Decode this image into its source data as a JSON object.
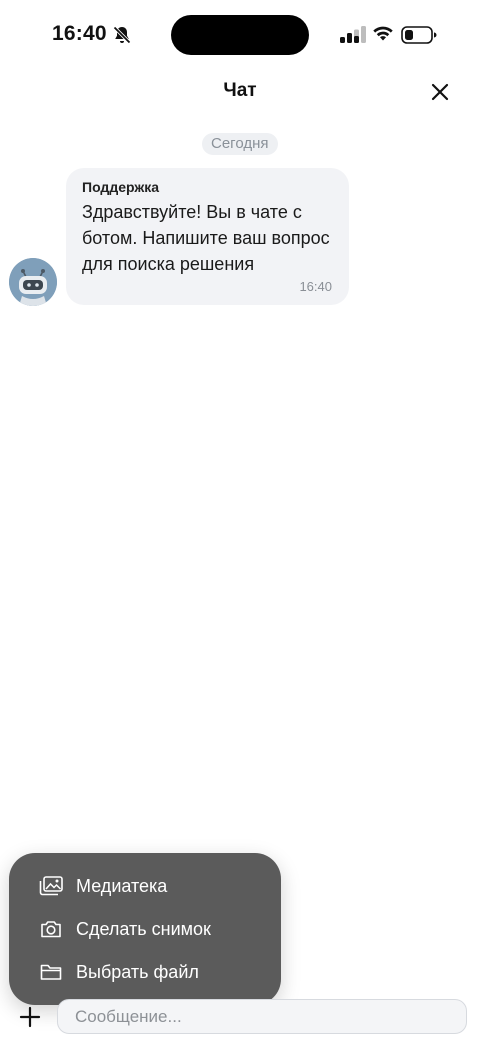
{
  "status_bar": {
    "time": "16:40",
    "icons": [
      "bell-slash-icon",
      "cellular-signal-icon",
      "wifi-icon",
      "battery-icon"
    ]
  },
  "header": {
    "title": "Чат",
    "close_icon": "close-icon"
  },
  "chat": {
    "date_label": "Сегодня",
    "messages": [
      {
        "sender": "Поддержка",
        "text": "Здравствуйте! Вы в чате с ботом. Напишите ваш вопрос для поиска решения",
        "time": "16:40",
        "avatar_icon": "bot-icon"
      }
    ]
  },
  "attach_menu": {
    "items": [
      {
        "label": "Медиатека",
        "icon": "photo-library-icon"
      },
      {
        "label": "Сделать снимок",
        "icon": "camera-icon"
      },
      {
        "label": "Выбрать файл",
        "icon": "folder-icon"
      }
    ]
  },
  "composer": {
    "plus_icon": "plus-icon",
    "placeholder": "Сообщение...",
    "value": ""
  },
  "colors": {
    "menu_background": "#5b5b5b",
    "bubble_background": "#f2f3f6",
    "avatar_background": "#7f9fba",
    "date_chip_background": "#eef0f3"
  }
}
